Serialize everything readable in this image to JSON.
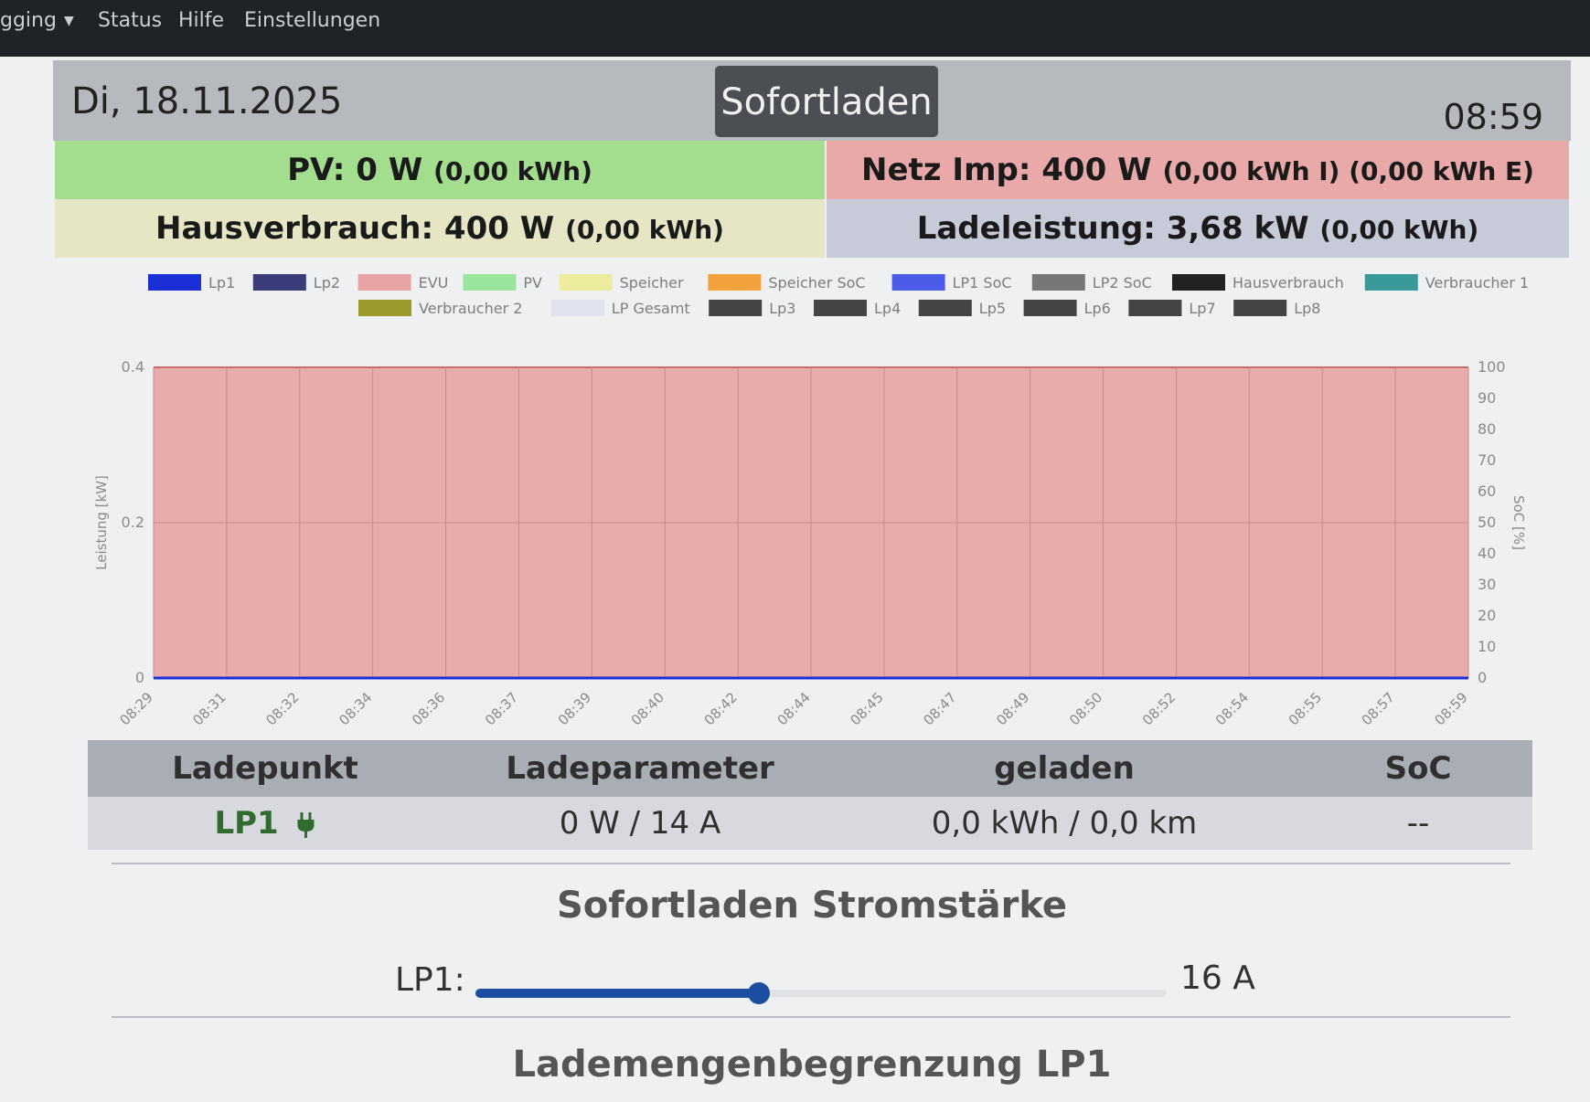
{
  "nav": {
    "logging": "gging",
    "status": "Status",
    "hilfe": "Hilfe",
    "einstellungen": "Einstellungen"
  },
  "header": {
    "date": "Di, 18.11.2025",
    "mode": "Sofortladen",
    "time": "08:59"
  },
  "tiles": {
    "pv_main": "PV: 0 W",
    "pv_energy": "(0,00 kWh)",
    "netz_main": "Netz Imp: 400 W",
    "netz_energy": "(0,00 kWh I) (0,00 kWh E)",
    "haus_main": "Hausverbrauch: 400 W",
    "haus_energy": "(0,00 kWh)",
    "lade_main": "Ladeleistung: 3,68 kW",
    "lade_energy": "(0,00 kWh)"
  },
  "chart_data": {
    "type": "area",
    "ylabel": "Leistung [kW]",
    "y2label": "SoC [%]",
    "ylim": [
      0,
      0.4
    ],
    "y_ticks": [
      "0",
      "0.2",
      "0.4"
    ],
    "y2lim": [
      0,
      100
    ],
    "y2_ticks": [
      "0",
      "10",
      "20",
      "30",
      "40",
      "50",
      "60",
      "70",
      "80",
      "90",
      "100"
    ],
    "x_ticks": [
      "08:29",
      "08:31",
      "08:32",
      "08:34",
      "08:36",
      "08:37",
      "08:39",
      "08:40",
      "08:42",
      "08:44",
      "08:45",
      "08:47",
      "08:49",
      "08:50",
      "08:52",
      "08:54",
      "08:55",
      "08:57",
      "08:59"
    ],
    "legend_position": "top",
    "grid": true,
    "legend": [
      {
        "name": "Lp1",
        "color": "#1a2fd6"
      },
      {
        "name": "Lp2",
        "color": "#3b3c7a"
      },
      {
        "name": "EVU",
        "color": "#e8a4a4"
      },
      {
        "name": "PV",
        "color": "#9be49b"
      },
      {
        "name": "Speicher",
        "color": "#ecec9c"
      },
      {
        "name": "Speicher SoC",
        "color": "#f3a13c"
      },
      {
        "name": "LP1 SoC",
        "color": "#4c5ae8"
      },
      {
        "name": "LP2 SoC",
        "color": "#777777"
      },
      {
        "name": "Hausverbrauch",
        "color": "#222222"
      },
      {
        "name": "Verbraucher 1",
        "color": "#3a9a9a"
      },
      {
        "name": "Verbraucher 2",
        "color": "#9a9a2a"
      },
      {
        "name": "LP Gesamt",
        "color": "#e0e3ee"
      },
      {
        "name": "Lp3",
        "color": "#444444"
      },
      {
        "name": "Lp4",
        "color": "#444444"
      },
      {
        "name": "Lp5",
        "color": "#444444"
      },
      {
        "name": "Lp6",
        "color": "#444444"
      },
      {
        "name": "Lp7",
        "color": "#444444"
      },
      {
        "name": "Lp8",
        "color": "#444444"
      }
    ],
    "series": [
      {
        "name": "EVU",
        "color": "#e8a4a4",
        "values": [
          0.4,
          0.4,
          0.4,
          0.4,
          0.4,
          0.4,
          0.4,
          0.4,
          0.4,
          0.4,
          0.4,
          0.4,
          0.4,
          0.4,
          0.4,
          0.4,
          0.4,
          0.4,
          0.4
        ]
      },
      {
        "name": "Lp1",
        "color": "#1a2fd6",
        "values": [
          0,
          0,
          0,
          0,
          0,
          0,
          0,
          0,
          0,
          0,
          0,
          0,
          0,
          0,
          0,
          0,
          0,
          0,
          0
        ]
      }
    ]
  },
  "table": {
    "headers": [
      "Ladepunkt",
      "Ladeparameter",
      "geladen",
      "SoC"
    ],
    "row": {
      "name": "LP1",
      "params": "0 W / 14 A",
      "charged": "0,0 kWh / 0,0 km",
      "soc": "--"
    }
  },
  "sofortladen": {
    "title": "Sofortladen Stromstärke",
    "label": "LP1:",
    "value": "16 A",
    "slider_fraction": 0.41
  },
  "lademengen": {
    "title": "Lademengenbegrenzung LP1"
  }
}
